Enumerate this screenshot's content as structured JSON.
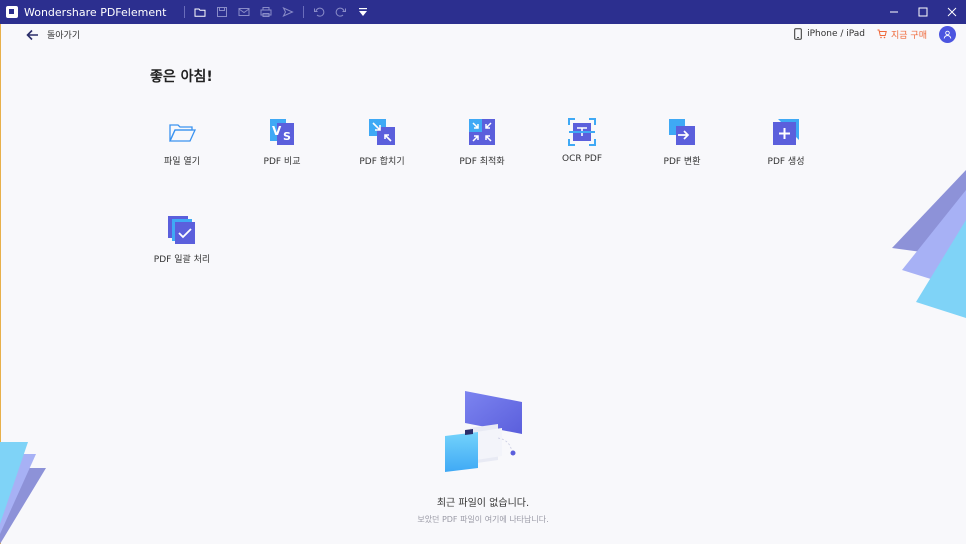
{
  "titlebar": {
    "app_title": "Wondershare PDFelement",
    "icons": [
      "folder-icon",
      "save-icon",
      "mail-icon",
      "print-icon",
      "share-icon",
      "undo-icon",
      "redo-icon",
      "dropdown-icon"
    ],
    "color": "#2c2f8f"
  },
  "nav": {
    "back_label": "돌아가기"
  },
  "topright": {
    "device_label": "iPhone / iPad",
    "buy_label": "지금 구매",
    "buy_color": "#ef6a3b",
    "avatar_color": "#4c55e0"
  },
  "home": {
    "greeting": "좋은 아침!"
  },
  "tools": [
    {
      "label": "파일 열기",
      "icon": "folder-open-icon"
    },
    {
      "label": "PDF 비교",
      "icon": "compare-icon"
    },
    {
      "label": "PDF 합치기",
      "icon": "combine-icon"
    },
    {
      "label": "PDF 최적화",
      "icon": "optimize-icon"
    },
    {
      "label": "OCR PDF",
      "icon": "ocr-icon"
    },
    {
      "label": "PDF 변환",
      "icon": "convert-icon"
    },
    {
      "label": "PDF 생성",
      "icon": "create-icon"
    },
    {
      "label": "PDF 일괄 처리",
      "icon": "batch-icon"
    }
  ],
  "recent": {
    "empty_title": "최근 파일이 없습니다.",
    "empty_subtitle": "보았던 PDF 파일이 여기에 나타납니다."
  }
}
